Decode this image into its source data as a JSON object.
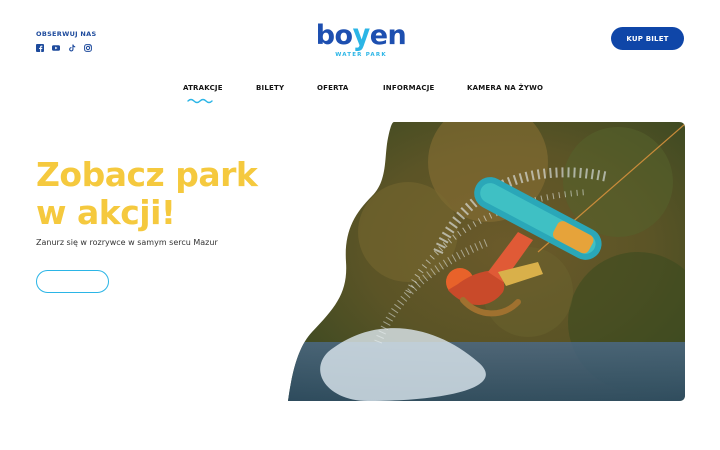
{
  "social": {
    "title": "OBSERWUJ NAS",
    "icons": [
      "facebook-icon",
      "youtube-icon",
      "tiktok-icon",
      "instagram-icon"
    ]
  },
  "logo": {
    "word_before": "bo",
    "word_y": "y",
    "word_after": "en",
    "subtitle": "WATER PARK"
  },
  "header": {
    "buy_label": "KUP BILET"
  },
  "nav": {
    "items": [
      {
        "label": "ATRAKCJE",
        "active": true
      },
      {
        "label": "BILETY",
        "active": false
      },
      {
        "label": "OFERTA",
        "active": false
      },
      {
        "label": "INFORMACJE",
        "active": false
      },
      {
        "label": "KAMERA NA ŻYWO",
        "active": false
      }
    ]
  },
  "hero": {
    "title_line1": "Zobacz park",
    "title_line2": "w akcji!",
    "subtitle": "Zanurz się w rozrywce w samym sercu Mazur",
    "button_label": ""
  },
  "colors": {
    "brand_blue": "#0f46a8",
    "accent_cyan": "#2bb5e6",
    "title_yellow": "#f5c93e"
  }
}
